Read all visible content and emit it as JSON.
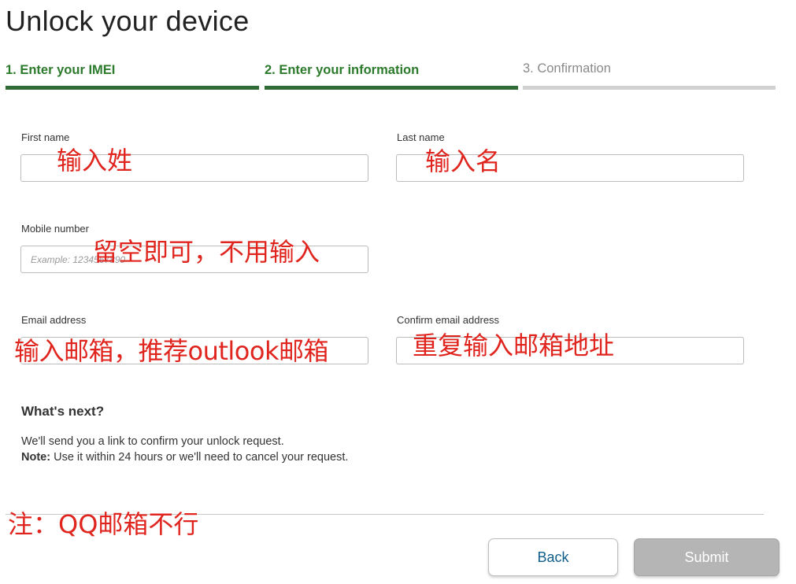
{
  "page": {
    "title": "Unlock your device"
  },
  "steps": [
    {
      "label": "1. Enter your IMEI",
      "state": "done"
    },
    {
      "label": "2. Enter your information",
      "state": "active"
    },
    {
      "label": "3. Confirmation",
      "state": "pending"
    }
  ],
  "form": {
    "first_name": {
      "label": "First name",
      "value": "",
      "placeholder": ""
    },
    "last_name": {
      "label": "Last name",
      "value": "",
      "placeholder": ""
    },
    "mobile": {
      "label": "Mobile number",
      "value": "",
      "placeholder": "Example: 1234567890"
    },
    "email": {
      "label": "Email address",
      "value": "",
      "placeholder": ""
    },
    "confirm_email": {
      "label": "Confirm email address",
      "value": "",
      "placeholder": ""
    }
  },
  "annotations": {
    "first_name": "输入姓",
    "last_name": "输入名",
    "mobile": "留空即可，不用输入",
    "email": "输入邮箱，推荐outlook邮箱",
    "confirm_email": "重复输入邮箱地址",
    "qq_note": "注：QQ邮箱不行"
  },
  "next": {
    "heading": "What's next?",
    "line1": "We'll send you a link to confirm your unlock request.",
    "note_label": "Note:",
    "note_text": " Use it within 24 hours or we'll need to cancel your request."
  },
  "buttons": {
    "back": "Back",
    "submit": "Submit"
  },
  "colors": {
    "step_active": "#2e6b35",
    "step_pending": "#d1d1d1",
    "annotation": "#e0251f",
    "back_text": "#0f5d8a",
    "submit_disabled": "#b5b5b5"
  }
}
